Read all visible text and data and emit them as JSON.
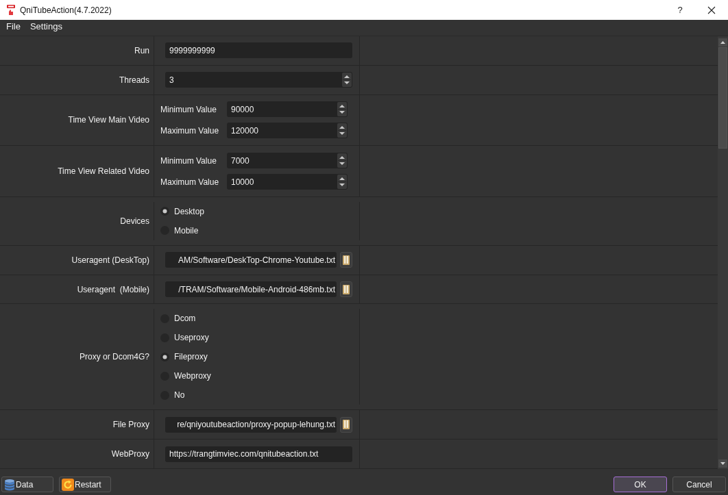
{
  "window": {
    "title": "QniTubeAction(4.7.2022)",
    "help_button": "?"
  },
  "menu": [
    "File",
    "Settings"
  ],
  "form": {
    "rows": [
      {
        "kind": "text",
        "label": "Run",
        "value": "9999999999"
      },
      {
        "kind": "spin",
        "label": "Threads",
        "value": "3"
      },
      {
        "kind": "range",
        "label": "Time View Main Video",
        "fields": [
          {
            "label": "Minimum Value",
            "value": "90000"
          },
          {
            "label": "Maximum Value",
            "value": "120000"
          }
        ]
      },
      {
        "kind": "range",
        "label": "Time View Related Video",
        "fields": [
          {
            "label": "Minimum Value",
            "value": "7000"
          },
          {
            "label": "Maximum Value",
            "value": "10000"
          }
        ]
      },
      {
        "kind": "radio",
        "label": "Devices",
        "options": [
          {
            "label": "Desktop",
            "selected": true
          },
          {
            "label": "Mobile",
            "selected": false
          }
        ]
      },
      {
        "kind": "file",
        "label": "Useragent (DeskTop)",
        "value": "AM/Software/DeskTop-Chrome-Youtube.txt"
      },
      {
        "kind": "file",
        "label": "Useragent  (Mobile)",
        "value": "/TRAM/Software/Mobile-Android-486mb.txt"
      },
      {
        "kind": "radio",
        "label": "Proxy or Dcom4G?",
        "options": [
          {
            "label": "Dcom",
            "selected": false
          },
          {
            "label": "Useproxy",
            "selected": false
          },
          {
            "label": "Fileproxy",
            "selected": true
          },
          {
            "label": "Webproxy",
            "selected": false
          },
          {
            "label": "No",
            "selected": false
          }
        ]
      },
      {
        "kind": "file",
        "label": "File Proxy",
        "value": "re/qniyoutubeaction/proxy-popup-lehung.txt"
      },
      {
        "kind": "text",
        "label": "WebProxy",
        "value": "https://trangtimviec.com/qnitubeaction.txt"
      }
    ]
  },
  "footer": {
    "left_buttons": [
      {
        "kind": "data",
        "label": "Data"
      },
      {
        "kind": "restart",
        "label": "Restart"
      }
    ],
    "right_buttons": [
      {
        "label": "OK",
        "focused": true
      },
      {
        "label": "Cancel",
        "focused": false
      }
    ]
  }
}
